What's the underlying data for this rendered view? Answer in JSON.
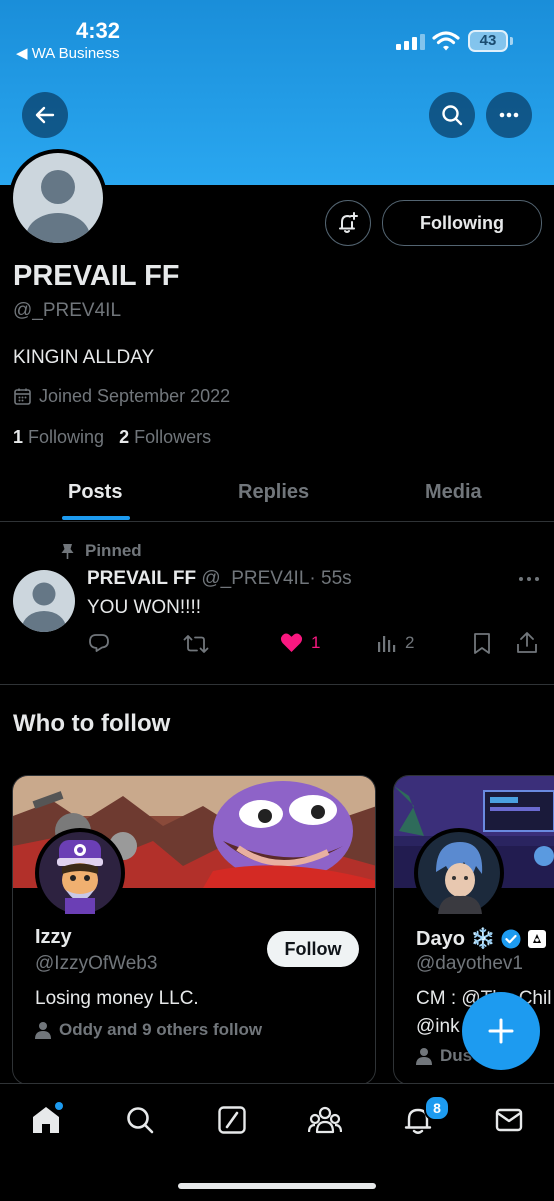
{
  "status_bar": {
    "time": "4:32",
    "back_app": "◀ WA Business",
    "battery": "43"
  },
  "profile": {
    "name": "PREVAIL FF",
    "handle": "@_PREV4IL",
    "bio": "KINGIN ALLDAY",
    "joined": "Joined September 2022",
    "following_count": "1",
    "following_label": "Following",
    "followers_count": "2",
    "followers_label": "Followers",
    "follow_button": "Following"
  },
  "tabs": [
    {
      "label": "Posts"
    },
    {
      "label": "Replies"
    },
    {
      "label": "Media"
    }
  ],
  "pinned_post": {
    "pinned_label": "Pinned",
    "author_name": "PREVAIL FF",
    "author_handle": "@_PREV4IL",
    "time": "· 55s",
    "text": "YOU WON!!!!",
    "likes": "1",
    "views": "2"
  },
  "who_to_follow": {
    "title": "Who to follow",
    "cards": [
      {
        "name": "Izzy",
        "handle": "@IzzyOfWeb3",
        "bio": "Losing money LLC.",
        "social": "Oddy and 9 others follow",
        "follow_label": "Follow"
      },
      {
        "name": "Dayo ❄️",
        "handle": "@dayothev1",
        "bio_line1": "CM : @The Chil",
        "bio_line2": "@ink Cu",
        "social": "Dus and"
      }
    ]
  },
  "tab_bar": {
    "notifications_badge": "8"
  },
  "colors": {
    "accent": "#1d9bf0",
    "like": "#f91880",
    "banner": "#1d9bf0",
    "background": "#000000"
  },
  "icons": [
    "back-arrow-icon",
    "search-icon",
    "more-icon",
    "bell-plus-icon",
    "calendar-icon",
    "pin-icon",
    "reply-icon",
    "retweet-icon",
    "heart-icon",
    "views-icon",
    "bookmark-icon",
    "share-icon",
    "person-icon",
    "verified-icon",
    "home-icon",
    "grok-icon",
    "communities-icon",
    "bell-icon",
    "mail-icon",
    "plus-icon"
  ]
}
